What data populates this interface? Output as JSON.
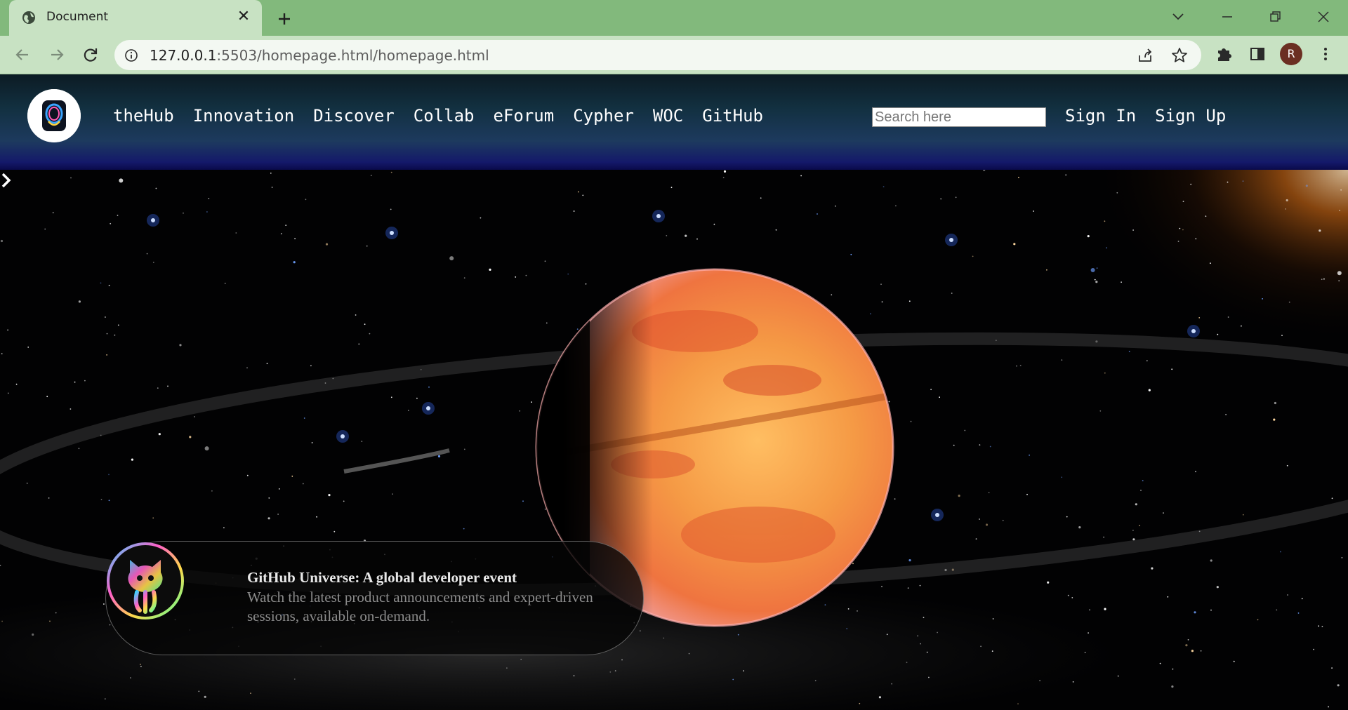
{
  "browser": {
    "tab_title": "Document",
    "url_host": "127.0.0.1",
    "url_rest": ":5503/homepage.html/homepage.html",
    "profile_initial": "R"
  },
  "site": {
    "nav": [
      {
        "label": "theHub"
      },
      {
        "label": "Innovation"
      },
      {
        "label": "Discover"
      },
      {
        "label": "Collab"
      },
      {
        "label": "eForum"
      },
      {
        "label": "Cypher"
      },
      {
        "label": "WOC"
      },
      {
        "label": "GitHub"
      }
    ],
    "search_placeholder": "Search here",
    "sign_in": "Sign In",
    "sign_up": "Sign Up"
  },
  "event": {
    "title": "GitHub Universe: A global developer event",
    "description": "Watch the latest product announcements and expert-driven sessions, available on-demand."
  },
  "colors": {
    "tab_strip": "#82b97c",
    "toolbar": "#c8e2c3",
    "header_dark": "#0c1b24",
    "header_accent": "#14196a",
    "planet": "#f08a3c"
  }
}
